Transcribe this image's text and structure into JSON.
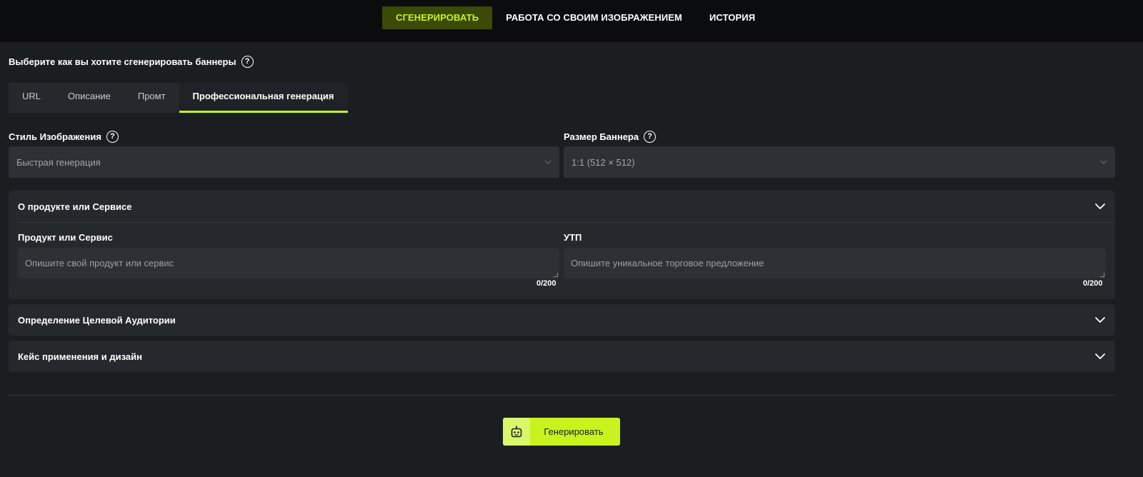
{
  "nav": {
    "tabs": [
      {
        "label": "СГЕНЕРИРОВАТЬ"
      },
      {
        "label": "РАБОТА СО СВОИМ ИЗОБРАЖЕНИЕМ"
      },
      {
        "label": "ИСТОРИЯ"
      }
    ]
  },
  "mode": {
    "question": "Выберите как вы хотите сгенерировать баннеры",
    "tabs": [
      {
        "label": "URL"
      },
      {
        "label": "Описание"
      },
      {
        "label": "Промт"
      },
      {
        "label": "Профессиональная генерация"
      }
    ]
  },
  "style": {
    "label": "Стиль Изображения",
    "value": "Быстрая генерация"
  },
  "size": {
    "label": "Размер Баннера",
    "value": "1:1 (512 × 512)"
  },
  "product_panel": {
    "title": "О продукте или Сервисе",
    "product": {
      "label": "Продукт или Сервис",
      "placeholder": "Опишите свой продукт или сервис",
      "counter": "0/200"
    },
    "usp": {
      "label": "УТП",
      "placeholder": "Опишите уникальное торговое предложение",
      "counter": "0/200"
    }
  },
  "audience_panel": {
    "title": "Определение Целевой Аудитории"
  },
  "case_panel": {
    "title": "Кейс применения и дизайн"
  },
  "generate_button": {
    "label": "Генерировать"
  },
  "colors": {
    "accent": "#c8f31d",
    "background": "#1b1e21",
    "header": "#0a0c0d",
    "panel": "#25282c",
    "field": "#2d3034"
  },
  "icons": {
    "help": "question-circle-icon",
    "chevron": "chevron-down-icon",
    "generate": "robot-icon"
  }
}
